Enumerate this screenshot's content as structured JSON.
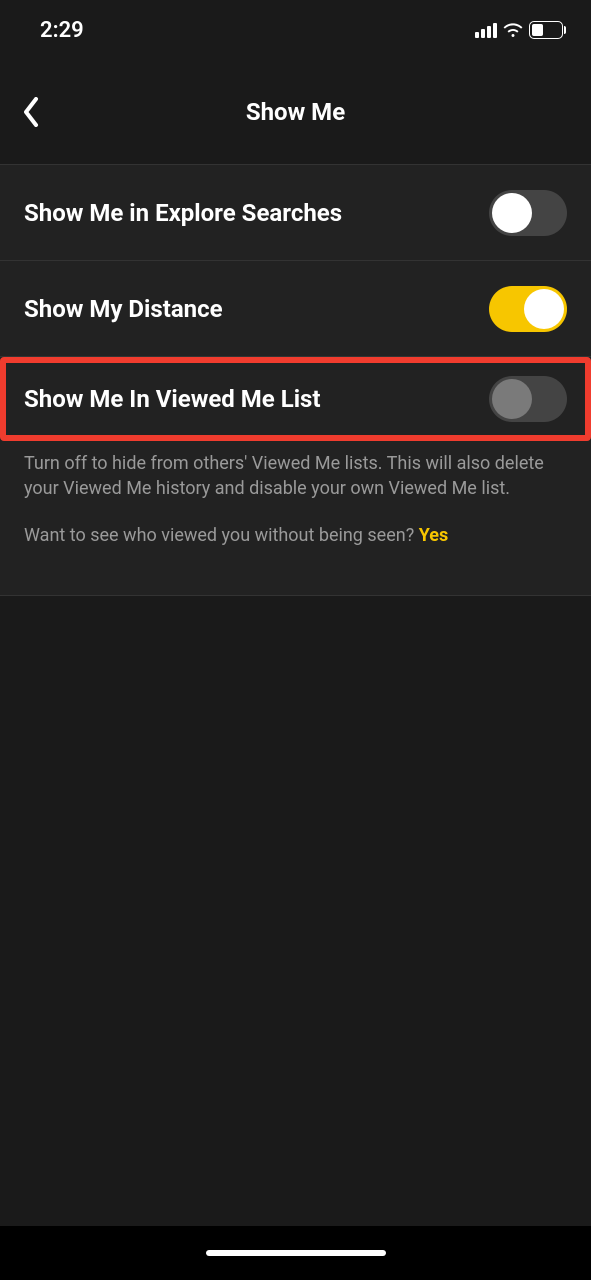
{
  "status": {
    "time": "2:29",
    "battery_pct": "37"
  },
  "header": {
    "title": "Show Me"
  },
  "rows": {
    "explore": {
      "label": "Show Me in Explore Searches",
      "on": false
    },
    "distance": {
      "label": "Show My Distance",
      "on": true
    },
    "viewed": {
      "label": "Show Me In Viewed Me List",
      "on": false
    }
  },
  "help": {
    "desc": "Turn off to hide from others' Viewed Me lists. This will also delete your Viewed Me history and disable your own Viewed Me list.",
    "prompt_prefix": "Want to see who viewed you without being seen? ",
    "prompt_link": "Yes"
  }
}
